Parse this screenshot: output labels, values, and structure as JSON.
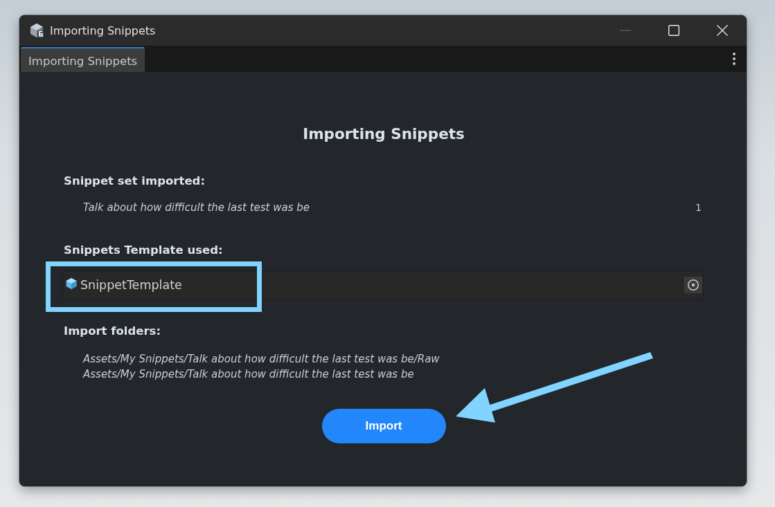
{
  "window": {
    "title": "Importing Snippets",
    "controls": [
      {
        "kind": "minimize",
        "disabled": true
      },
      {
        "kind": "maximize",
        "disabled": false
      },
      {
        "kind": "close",
        "disabled": false
      }
    ]
  },
  "tabs": [
    {
      "label": "Importing Snippets",
      "selected": true
    }
  ],
  "heading": "Importing Snippets",
  "snippet_set": {
    "label": "Snippet set imported:",
    "rows": [
      {
        "name": "Talk about how difficult the last test was be",
        "count": "1"
      }
    ]
  },
  "template": {
    "label": "Snippets Template used:",
    "value": "SnippetTemplate",
    "highlighted": true
  },
  "import_folders": {
    "label": "Import folders:",
    "paths": [
      "Assets/My Snippets/Talk about how difficult the last test was be/Raw",
      "Assets/My Snippets/Talk about how difficult the last test was be"
    ]
  },
  "import_button": {
    "label": "Import",
    "pointed_at": true
  }
}
